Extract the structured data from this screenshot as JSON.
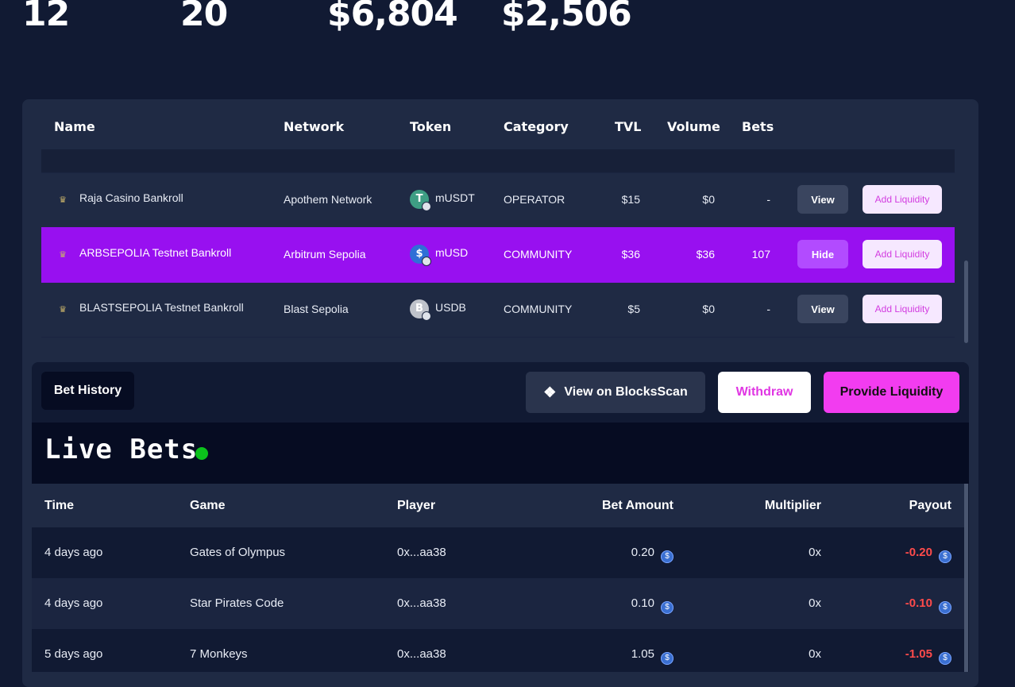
{
  "stats": [
    "12",
    "20",
    "$6,804",
    "$2,506"
  ],
  "bankroll_table": {
    "headers": {
      "name": "Name",
      "network": "Network",
      "token": "Token",
      "category": "Category",
      "tvl": "TVL",
      "volume": "Volume",
      "bets": "Bets"
    },
    "rows": [
      {
        "name": "Raja Casino Bankroll",
        "network": "Apothem Network",
        "token": "mUSDT",
        "token_icon": "tether-icon",
        "token_color": "#3e9e84",
        "category": "OPERATOR",
        "tvl": "$15",
        "volume": "$0",
        "bets": "-",
        "toggle": "View",
        "add": "Add Liquidity"
      },
      {
        "name": "ARBSEPOLIA Testnet Bankroll",
        "network": "Arbitrum Sepolia",
        "token": "mUSD",
        "token_icon": "usd-coin-icon",
        "token_color": "#2f6fd6",
        "category": "COMMUNITY",
        "tvl": "$36",
        "volume": "$36",
        "bets": "107",
        "toggle": "Hide",
        "add": "Add Liquidity"
      },
      {
        "name": "BLASTSEPOLIA Testnet Bankroll",
        "network": "Blast Sepolia",
        "token": "USDB",
        "token_icon": "usdb-icon",
        "token_color": "#bfc3cb",
        "category": "COMMUNITY",
        "tvl": "$5",
        "volume": "$0",
        "bets": "-",
        "toggle": "View",
        "add": "Add Liquidity"
      }
    ]
  },
  "actions": {
    "bet_history": "Bet History",
    "blocksscan": "View on BlocksScan",
    "withdraw": "Withdraw",
    "provide": "Provide Liquidity"
  },
  "live_bets": {
    "title": "Live Bets",
    "headers": {
      "time": "Time",
      "game": "Game",
      "player": "Player",
      "bet_amount": "Bet Amount",
      "multiplier": "Multiplier",
      "payout": "Payout"
    },
    "rows": [
      {
        "time": "4 days ago",
        "game": "Gates of Olympus",
        "player": "0x...aa38",
        "bet": "0.20",
        "multiplier": "0x",
        "payout": "-0.20"
      },
      {
        "time": "4 days ago",
        "game": "Star Pirates Code",
        "player": "0x...aa38",
        "bet": "0.10",
        "multiplier": "0x",
        "payout": "-0.10"
      },
      {
        "time": "5 days ago",
        "game": "7 Monkeys",
        "player": "0x...aa38",
        "bet": "1.05",
        "multiplier": "0x",
        "payout": "-1.05"
      }
    ]
  },
  "colors": {
    "background": "#111a33",
    "panel": "#1f2a44",
    "active_row": "#9810f0",
    "accent": "#f23cf0",
    "negative": "#ff4b4b",
    "live_indicator": "#0bc21c"
  }
}
